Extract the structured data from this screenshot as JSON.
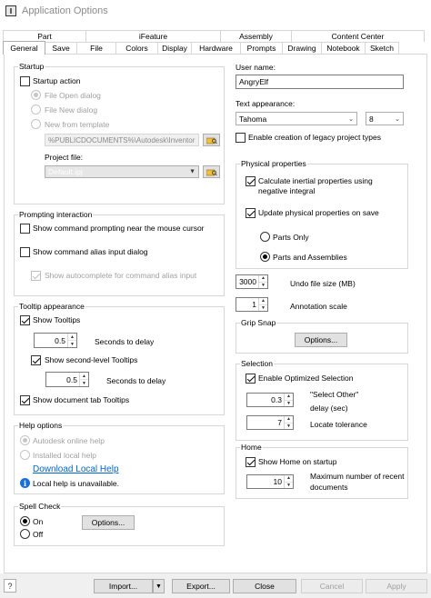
{
  "window": {
    "title": "Application Options",
    "icon_letter": "I"
  },
  "tabs_row1": [
    {
      "label": "Part",
      "width": 92
    },
    {
      "label": "iFeature",
      "width": 149
    },
    {
      "label": "Assembly",
      "width": 79
    },
    {
      "label": "Content Center",
      "width": 147
    }
  ],
  "tabs_row2": [
    {
      "label": "General",
      "width": 47,
      "active": true
    },
    {
      "label": "Save",
      "width": 36
    },
    {
      "label": "File",
      "width": 44
    },
    {
      "label": "Colors",
      "width": 47
    },
    {
      "label": "Display",
      "width": 38
    },
    {
      "label": "Hardware",
      "width": 55
    },
    {
      "label": "Prompts",
      "width": 47
    },
    {
      "label": "Drawing",
      "width": 44
    },
    {
      "label": "Notebook",
      "width": 49
    },
    {
      "label": "Sketch",
      "width": 38
    }
  ],
  "startup": {
    "title": "Startup",
    "action_label": "Startup action",
    "file_open": "File Open dialog",
    "file_new": "File New dialog",
    "new_template": "New from template",
    "template_path": "%PUBLICDOCUMENTS%\\Autodesk\\Inventor",
    "project_label": "Project file:",
    "project_value": "Default.ipj"
  },
  "prompting": {
    "title": "Prompting interaction",
    "cmd_prompting": "Show command prompting near the mouse cursor",
    "cmd_alias": "Show command alias input dialog",
    "autocomplete": "Show autocomplete for command alias input"
  },
  "tooltip": {
    "title": "Tooltip appearance",
    "show_tooltips": "Show Tooltips",
    "delay1_value": "0.5",
    "delay1_label": "Seconds to delay",
    "show_second": "Show second-level Tooltips",
    "delay2_value": "0.5",
    "delay2_label": "Seconds to delay",
    "doc_tab": "Show document tab Tooltips"
  },
  "help": {
    "title": "Help options",
    "online": "Autodesk online help",
    "local": "Installed local help",
    "download_link": "Download Local Help",
    "info_text": "Local help is unavailable."
  },
  "spell": {
    "title": "Spell Check",
    "on": "On",
    "off": "Off",
    "options": "Options..."
  },
  "user": {
    "label": "User name:",
    "value": "AngryElf"
  },
  "text_appearance": {
    "label": "Text appearance:",
    "font": "Tahoma",
    "size": "8"
  },
  "legacy": {
    "label": "Enable creation of legacy project types"
  },
  "physical": {
    "title": "Physical properties",
    "calc": "Calculate inertial properties using negative integral",
    "update": "Update physical properties on save",
    "parts_only": "Parts Only",
    "parts_asm": "Parts and Assemblies"
  },
  "undo": {
    "value": "3000",
    "label": "Undo file size (MB)"
  },
  "annotation": {
    "value": "1",
    "label": "Annotation scale"
  },
  "grip": {
    "title": "Grip Snap",
    "options": "Options..."
  },
  "selection": {
    "title": "Selection",
    "enable": "Enable Optimized Selection",
    "delay_value": "0.3",
    "delay_label1": "\"Select Other\"",
    "delay_label2": "delay (sec)",
    "tol_value": "7",
    "tol_label": "Locate tolerance"
  },
  "home": {
    "title": "Home",
    "show": "Show Home on startup",
    "max_value": "10",
    "max_label1": "Maximum number of recent",
    "max_label2": "documents"
  },
  "footer": {
    "import": "Import...",
    "export": "Export...",
    "close": "Close",
    "cancel": "Cancel",
    "apply": "Apply"
  }
}
